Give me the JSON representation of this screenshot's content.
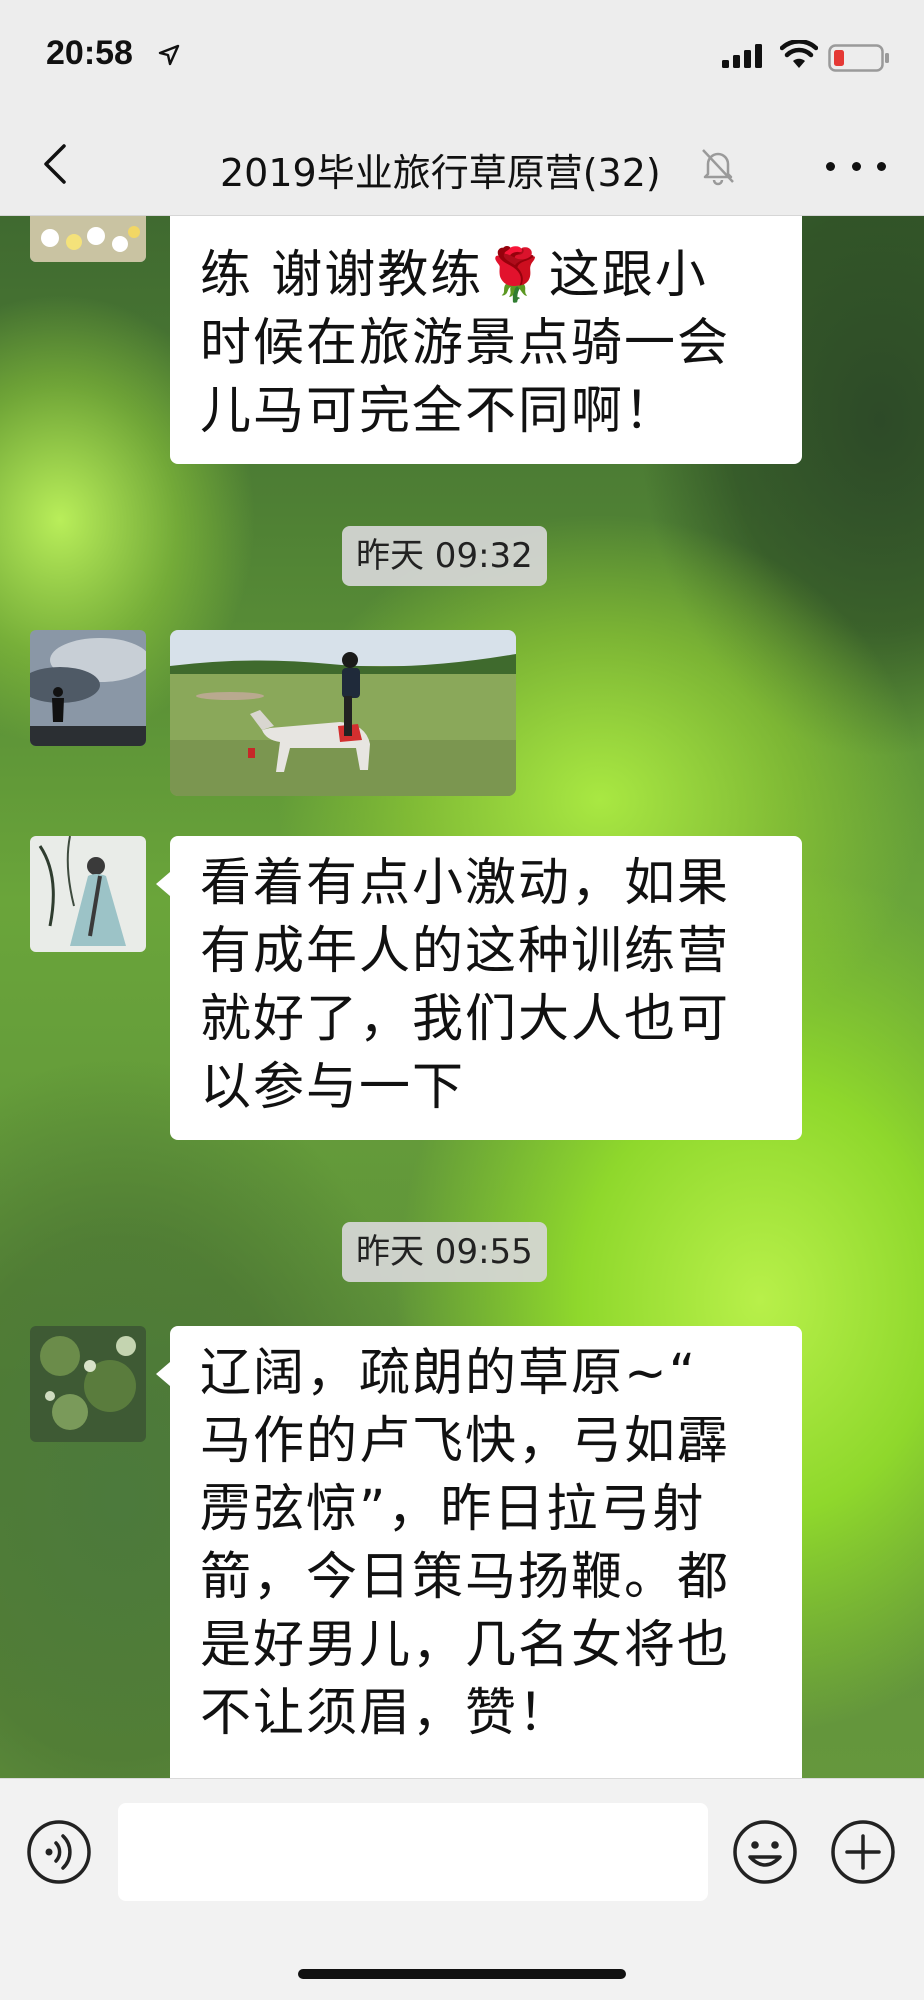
{
  "status_bar": {
    "time": "20:58"
  },
  "nav": {
    "title": "2019毕业旅行草原营(32)"
  },
  "messages": [
    {
      "lines": [
        "练 谢谢教练🌹这跟小",
        "时候在旅游景点骑一会",
        "儿马可完全不同啊！"
      ]
    },
    {
      "lines": [
        "看着有点小激动，如果",
        "有成年人的这种训练营",
        "就好了，我们大人也可",
        "以参与一下"
      ]
    },
    {
      "lines": [
        "辽阔，疏朗的草原~“",
        "马作的卢飞快，弓如霹",
        "雳弦惊”，昨日拉弓射",
        "箭，今日策马扬鞭。都",
        "是好男儿，几名女将也",
        "不让须眉，赞！"
      ]
    }
  ],
  "timestamps": [
    "昨天 09:32",
    "昨天 09:55"
  ],
  "input": {
    "value": "",
    "placeholder": ""
  },
  "icons": {
    "back": "chevron-left-icon",
    "mute": "bell-slash-icon",
    "more": "more-dots-icon",
    "voice": "voice-icon",
    "emoji": "emoji-icon",
    "plus": "plus-icon"
  },
  "colors": {
    "bar_bg": "#ededed",
    "bubble_bg": "#ffffff",
    "timestamp_bg": "#d7d7d7",
    "battery_low": "#e53935"
  }
}
